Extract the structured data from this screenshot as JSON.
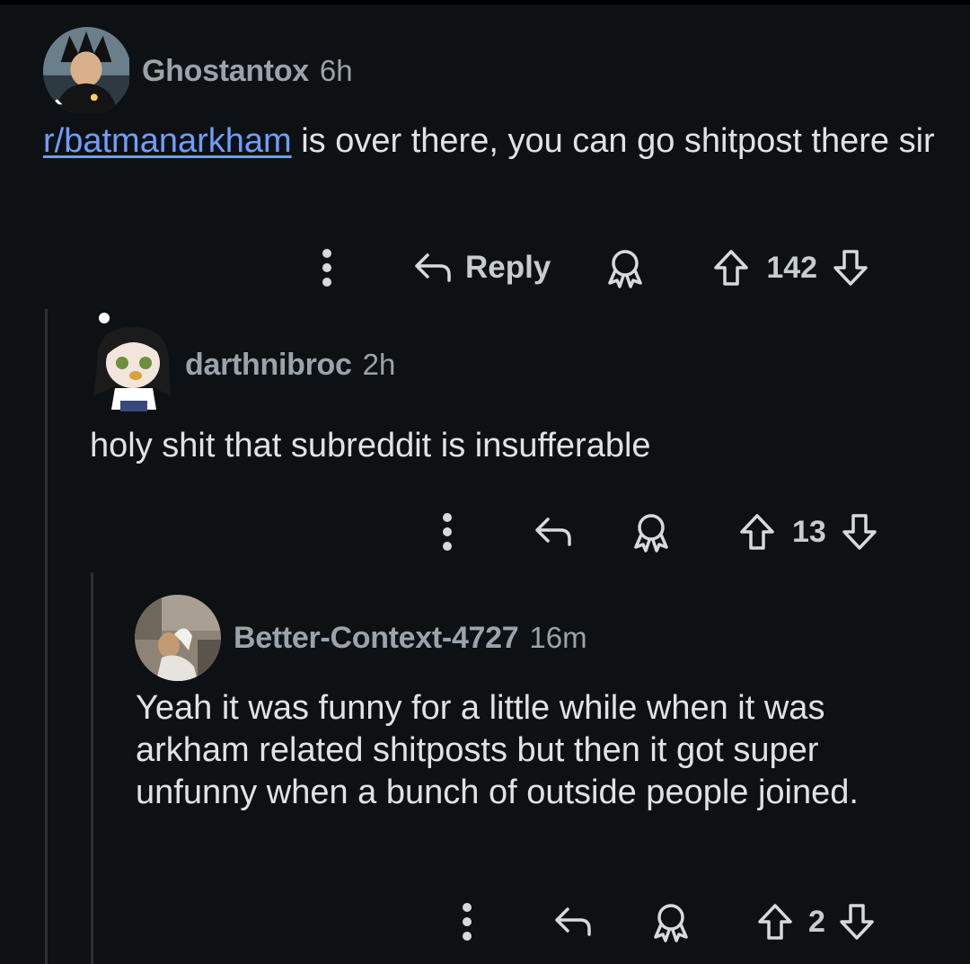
{
  "comments": [
    {
      "username": "Ghostantox",
      "time": "6h",
      "body_link": "r/batmanarkham",
      "body_text": " is over there, you can go shitpost there sir",
      "reply_label": "Reply",
      "score": "142",
      "avatar_icon": "avatar-goku-icon"
    },
    {
      "username": "darthnibroc",
      "time": "2h",
      "body_text": "holy shit that subreddit is insufferable",
      "score": "13",
      "avatar_icon": "avatar-snoo-icon"
    },
    {
      "username": "Better-Context-4727",
      "time": "16m",
      "body_text": "Yeah it was funny for a little while when it was arkham related shitposts but then it got super unfunny when a bunch of outside people joined.",
      "score": "2",
      "avatar_icon": "avatar-photo-icon"
    }
  ],
  "colors": {
    "background": "#0e1113",
    "link": "#6f9dff",
    "meta_text": "#9aa3ab",
    "thread_line": "#2a3035"
  },
  "icons": [
    "more-options-icon",
    "reply-arrow-icon",
    "award-icon",
    "upvote-icon",
    "downvote-icon"
  ]
}
